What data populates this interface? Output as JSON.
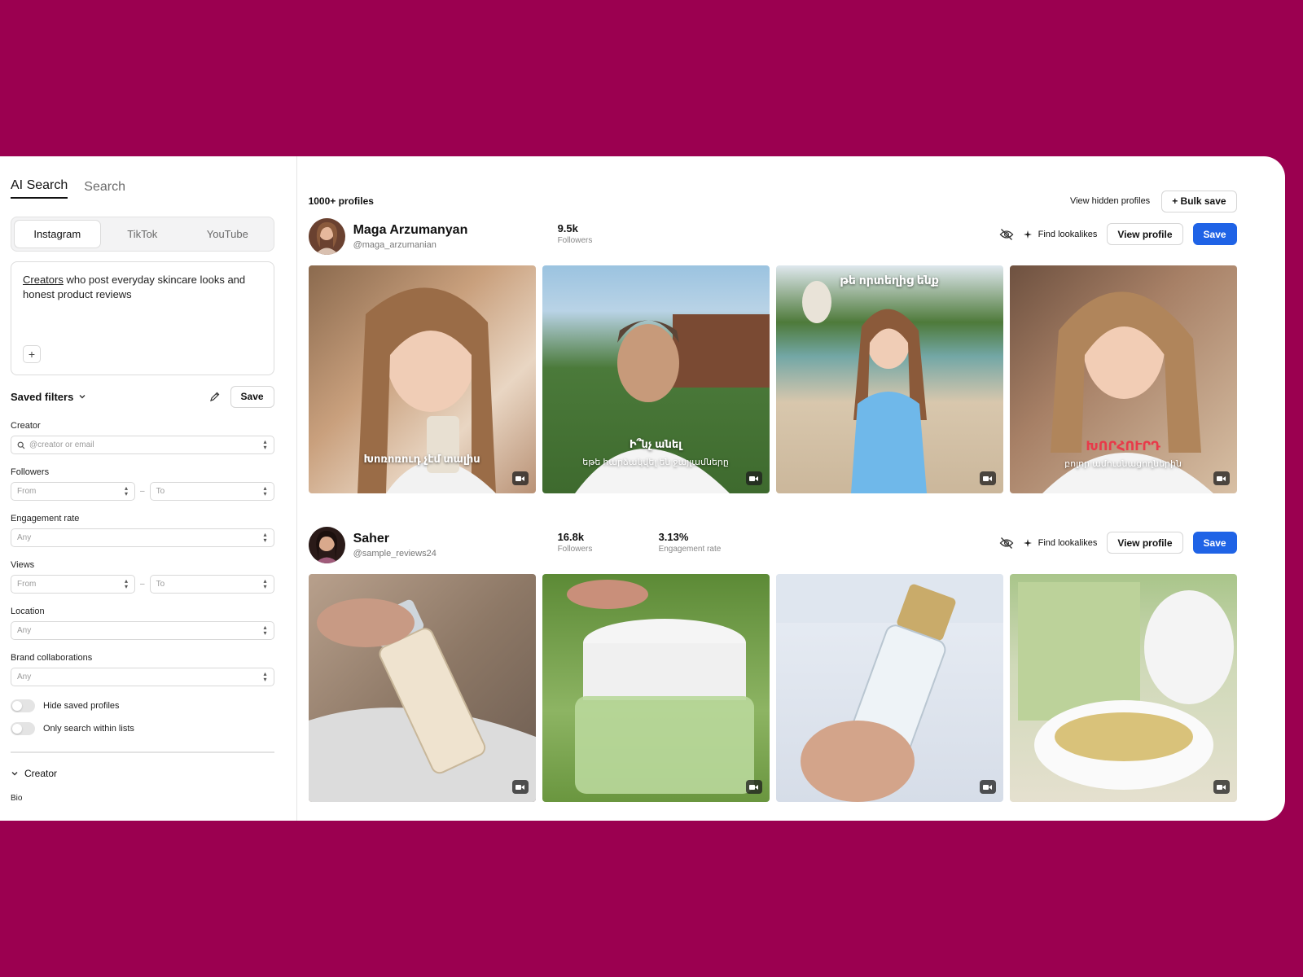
{
  "sidebar": {
    "tabs": [
      "AI Search",
      "Search"
    ],
    "platforms": [
      "Instagram",
      "TikTok",
      "YouTube"
    ],
    "prompt_word": "Creators",
    "prompt_rest": " who post everyday skincare looks and honest product reviews",
    "plus_label": "+",
    "saved_filters_label": "Saved filters",
    "save_label": "Save",
    "creator_label": "Creator",
    "creator_placeholder": "@creator or email",
    "followers_label": "Followers",
    "from_placeholder": "From",
    "to_placeholder": "To",
    "range_dash": "–",
    "engagement_label": "Engagement rate",
    "any_placeholder": "Any",
    "views_label": "Views",
    "location_label": "Location",
    "brand_label": "Brand collaborations",
    "hide_saved_label": "Hide saved profiles",
    "only_lists_label": "Only search within lists",
    "section_creator": "Creator",
    "bio_label": "Bio"
  },
  "main": {
    "count": "1000+ profiles",
    "view_hidden": "View hidden profiles",
    "bulk_save": "+ Bulk save",
    "find_lookalikes": "Find lookalikes",
    "view_profile": "View profile",
    "save": "Save",
    "profiles": [
      {
        "name": "Maga Arzumanyan",
        "handle": "@maga_arzumanian",
        "followers": "9.5k",
        "followers_label": "Followers",
        "media_captions": [
          {
            "top": "",
            "main": "Խոռոռուդ չէմ տալիս",
            "sub": ""
          },
          {
            "top": "",
            "main": "Ի՞նչ անել",
            "sub": "եթե հարձակվել են ջայլամները"
          },
          {
            "top": "թե որտեղից ենք",
            "main": "",
            "sub": ""
          },
          {
            "top": "",
            "main": "ԽՈՐՀՈՒՐԴ",
            "sub": "բոլոր ամուսնացողներին"
          }
        ]
      },
      {
        "name": "Saher",
        "handle": "@sample_reviews24",
        "followers": "16.8k",
        "followers_label": "Followers",
        "engagement": "3.13%",
        "engagement_label": "Engagement rate",
        "media_captions": [
          {
            "top": "",
            "main": "",
            "sub": ""
          },
          {
            "top": "",
            "main": "",
            "sub": ""
          },
          {
            "top": "",
            "main": "",
            "sub": ""
          },
          {
            "top": "",
            "main": "",
            "sub": ""
          }
        ]
      }
    ]
  },
  "colors": {
    "background": "#9b0050",
    "primary": "#1f63e6"
  }
}
